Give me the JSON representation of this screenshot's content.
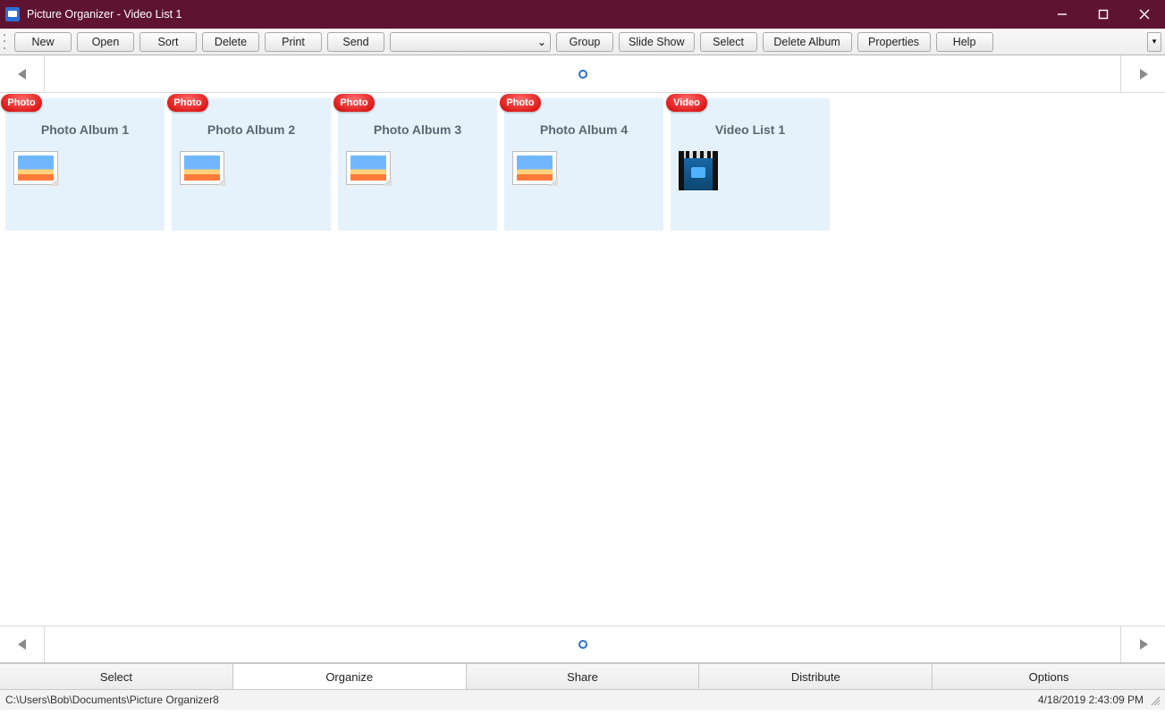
{
  "window": {
    "title": "Picture Organizer - Video List 1"
  },
  "toolbar": {
    "buttons": {
      "new": "New",
      "open": "Open",
      "sort": "Sort",
      "delete": "Delete",
      "print": "Print",
      "send": "Send",
      "group": "Group",
      "slideshow": "Slide Show",
      "select": "Select",
      "deletealbum": "Delete Album",
      "properties": "Properties",
      "help": "Help"
    },
    "combo_value": ""
  },
  "albums": [
    {
      "badge": "Photo",
      "title": "Photo Album 1",
      "type": "photo"
    },
    {
      "badge": "Photo",
      "title": "Photo Album 2",
      "type": "photo"
    },
    {
      "badge": "Photo",
      "title": "Photo Album 3",
      "type": "photo"
    },
    {
      "badge": "Photo",
      "title": "Photo Album 4",
      "type": "photo"
    },
    {
      "badge": "Video",
      "title": "Video List 1",
      "type": "video"
    }
  ],
  "bottom_tabs": {
    "select": "Select",
    "organize": "Organize",
    "share": "Share",
    "distribute": "Distribute",
    "options": "Options",
    "active": "organize"
  },
  "status": {
    "path": "C:\\Users\\Bob\\Documents\\Picture Organizer8",
    "datetime": "4/18/2019 2:43:09 PM"
  }
}
